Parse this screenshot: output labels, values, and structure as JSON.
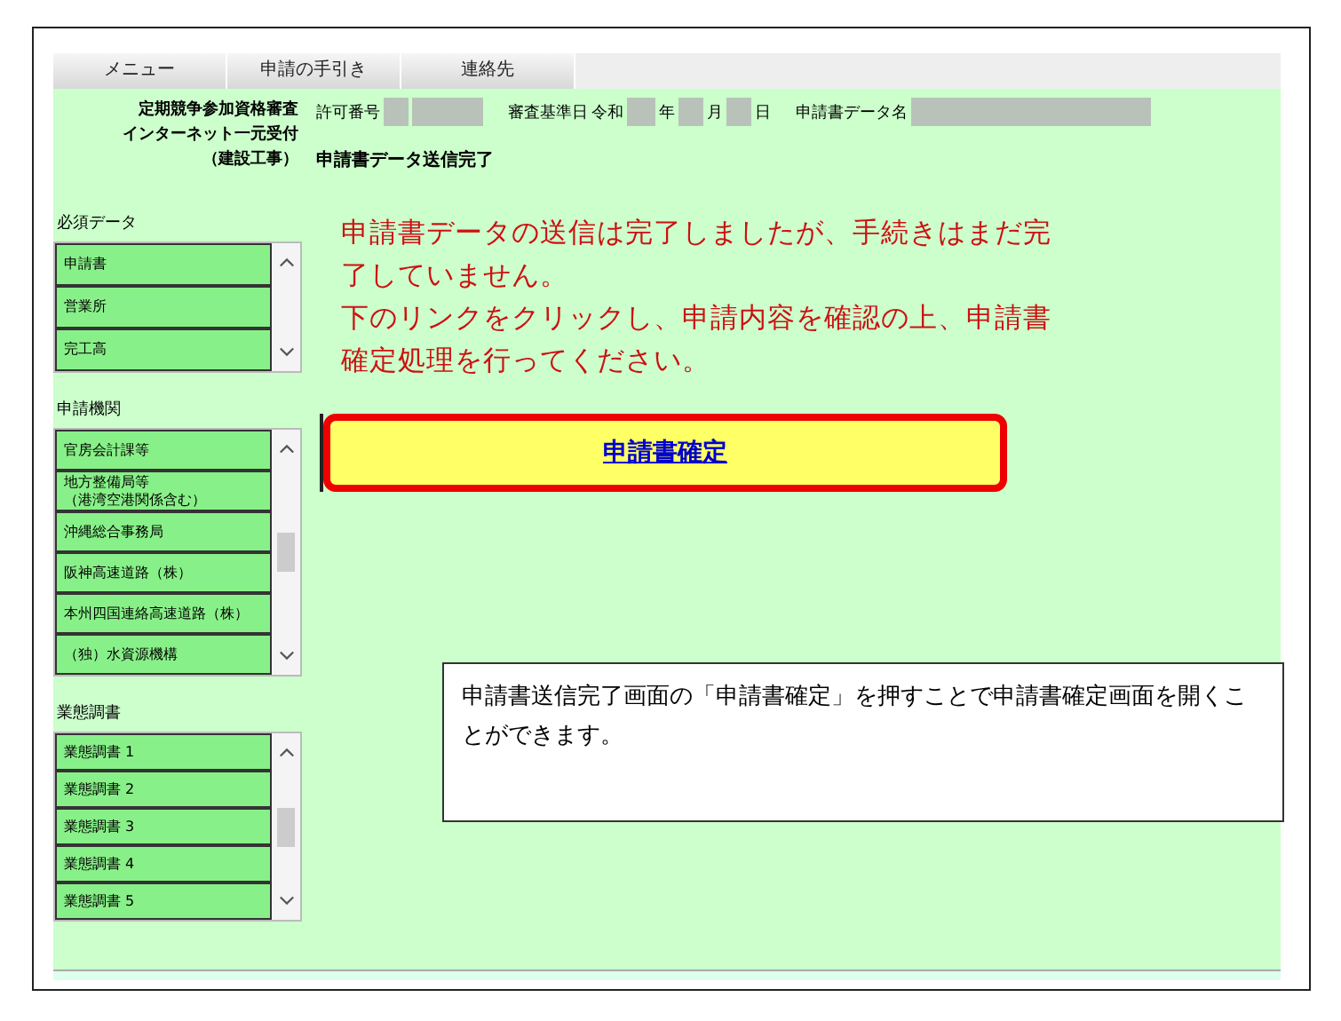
{
  "menu_tabs": [
    {
      "label": "メニュー",
      "selected": false
    },
    {
      "label": "申請の手引き",
      "selected": false
    },
    {
      "label": "連絡先",
      "selected": false
    }
  ],
  "header": {
    "system_title": [
      "定期競争参加資格審査",
      "インターネット一元受付",
      "（建設工事）"
    ],
    "permit_label": "許可番号",
    "date_label": "審査基準日",
    "era": "令和",
    "year_unit": "年",
    "month_unit": "月",
    "day_unit": "日",
    "data_name_label": "申請書データ名",
    "page_title": "申請書データ送信完了"
  },
  "sidebar": [
    {
      "heading": "必須データ",
      "items": [
        "申請書",
        "営業所",
        "完工高"
      ]
    },
    {
      "heading": "申請機関",
      "items": [
        "官房会計課等",
        "地方整備局等（港湾空港関係含む）",
        "沖縄総合事務局",
        "阪神高速道路（株）",
        "本州四国連絡高速道路（株）",
        "（独）水資源機構"
      ]
    },
    {
      "heading": "業態調書",
      "items": [
        "業態調書 1",
        "業態調書 2",
        "業態調書 3",
        "業態調書 4",
        "業態調書 5"
      ]
    }
  ],
  "message": [
    "申請書データの送信は完了しましたが、手続きはまだ完了していません。",
    "下のリンクをクリックし、申請内容を確認の上、申請書確定処理を行ってください。"
  ],
  "confirm_link": "申請書確定",
  "callout": "申請書送信完了画面の「申請書確定」を押すことで申請書確定画面を開くことができます。"
}
